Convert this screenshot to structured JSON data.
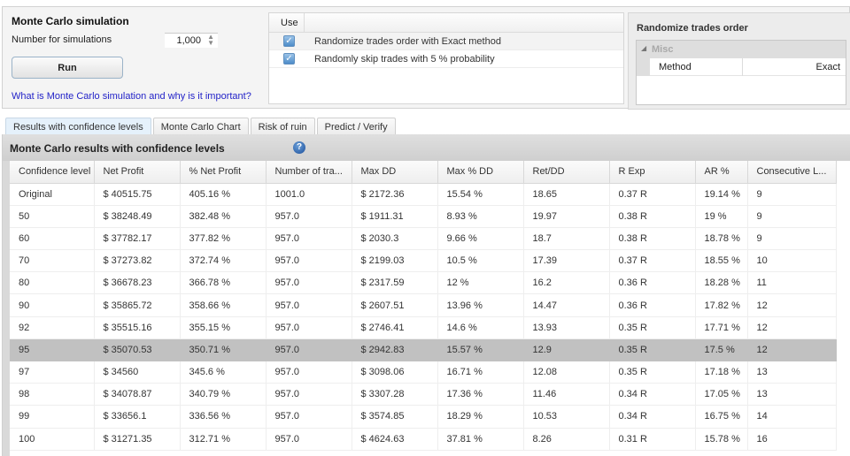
{
  "simulation": {
    "title": "Monte Carlo simulation",
    "number_label": "Number for simulations",
    "number_value": "1,000",
    "run_label": "Run",
    "help_link": "What is Monte Carlo simulation and why is it important?"
  },
  "options": {
    "header_use": "Use",
    "rows": [
      {
        "checked": true,
        "label": "Randomize trades order with Exact method"
      },
      {
        "checked": true,
        "label": "Randomly skip trades with 5 % probability"
      }
    ]
  },
  "randomize": {
    "title": "Randomize trades order",
    "category": "Misc",
    "property_name": "Method",
    "property_value": "Exact"
  },
  "tabs": [
    {
      "label": "Results with confidence levels",
      "active": true
    },
    {
      "label": "Monte Carlo Chart",
      "active": false
    },
    {
      "label": "Risk of ruin",
      "active": false
    },
    {
      "label": "Predict / Verify",
      "active": false
    }
  ],
  "results": {
    "title": "Monte Carlo results with confidence levels",
    "columns": [
      "Confidence level",
      "Net Profit",
      "% Net Profit",
      "Number of tra...",
      "Max DD",
      "Max % DD",
      "Ret/DD",
      "R Exp",
      "AR %",
      "Consecutive L..."
    ],
    "selected_row": 7,
    "rows": [
      [
        "Original",
        "$ 40515.75",
        "405.16 %",
        "1001.0",
        "$ 2172.36",
        "15.54 %",
        "18.65",
        "0.37 R",
        "19.14 %",
        "9"
      ],
      [
        "50",
        "$ 38248.49",
        "382.48 %",
        "957.0",
        "$ 1911.31",
        "8.93 %",
        "19.97",
        "0.38 R",
        "19 %",
        "9"
      ],
      [
        "60",
        "$ 37782.17",
        "377.82 %",
        "957.0",
        "$ 2030.3",
        "9.66 %",
        "18.7",
        "0.38 R",
        "18.78 %",
        "9"
      ],
      [
        "70",
        "$ 37273.82",
        "372.74 %",
        "957.0",
        "$ 2199.03",
        "10.5 %",
        "17.39",
        "0.37 R",
        "18.55 %",
        "10"
      ],
      [
        "80",
        "$ 36678.23",
        "366.78 %",
        "957.0",
        "$ 2317.59",
        "12 %",
        "16.2",
        "0.36 R",
        "18.28 %",
        "11"
      ],
      [
        "90",
        "$ 35865.72",
        "358.66 %",
        "957.0",
        "$ 2607.51",
        "13.96 %",
        "14.47",
        "0.36 R",
        "17.82 %",
        "12"
      ],
      [
        "92",
        "$ 35515.16",
        "355.15 %",
        "957.0",
        "$ 2746.41",
        "14.6 %",
        "13.93",
        "0.35 R",
        "17.71 %",
        "12"
      ],
      [
        "95",
        "$ 35070.53",
        "350.71 %",
        "957.0",
        "$ 2942.83",
        "15.57 %",
        "12.9",
        "0.35 R",
        "17.5 %",
        "12"
      ],
      [
        "97",
        "$ 34560",
        "345.6 %",
        "957.0",
        "$ 3098.06",
        "16.71 %",
        "12.08",
        "0.35 R",
        "17.18 %",
        "13"
      ],
      [
        "98",
        "$ 34078.87",
        "340.79 %",
        "957.0",
        "$ 3307.28",
        "17.36 %",
        "11.46",
        "0.34 R",
        "17.05 %",
        "13"
      ],
      [
        "99",
        "$ 33656.1",
        "336.56 %",
        "957.0",
        "$ 3574.85",
        "18.29 %",
        "10.53",
        "0.34 R",
        "16.75 %",
        "14"
      ],
      [
        "100",
        "$ 31271.35",
        "312.71 %",
        "957.0",
        "$ 4624.63",
        "37.81 %",
        "8.26",
        "0.31 R",
        "15.78 %",
        "16"
      ]
    ]
  }
}
